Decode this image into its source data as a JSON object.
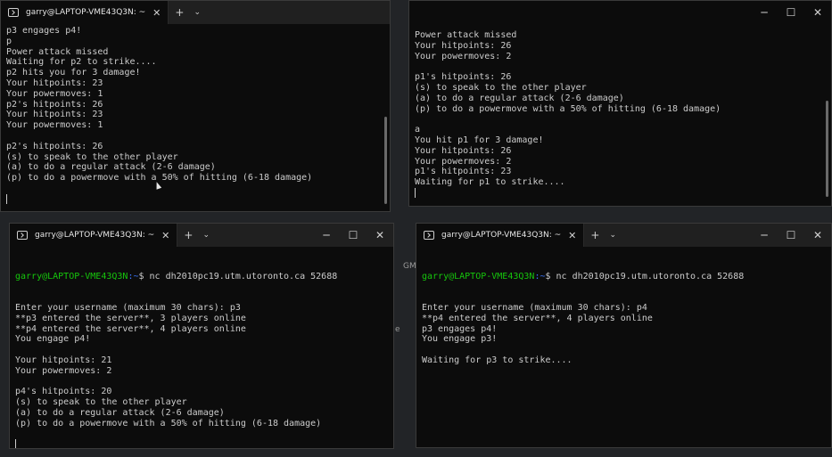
{
  "desktop": {
    "gap_label_1": "GM",
    "gap_label_2": "e"
  },
  "windows": {
    "top_left": {
      "tab_title": "garry@LAPTOP-VME43Q3N: ~",
      "lines": [
        "p3 engages p4!",
        "p",
        "Power attack missed",
        "Waiting for p2 to strike....",
        "p2 hits you for 3 damage!",
        "Your hitpoints: 23",
        "Your powermoves: 1",
        "p2's hitpoints: 26",
        "Your hitpoints: 23",
        "Your powermoves: 1",
        "",
        "p2's hitpoints: 26",
        "(s) to speak to the other player",
        "(a) to do a regular attack (2-6 damage)",
        "(p) to do a powermove with a 50% of hitting (6-18 damage)",
        "",
        ""
      ]
    },
    "top_right": {
      "lines": [
        "Power attack missed",
        "Your hitpoints: 26",
        "Your powermoves: 2",
        "",
        "p1's hitpoints: 26",
        "(s) to speak to the other player",
        "(a) to do a regular attack (2-6 damage)",
        "(p) to do a powermove with a 50% of hitting (6-18 damage)",
        "",
        "a",
        "You hit p1 for 3 damage!",
        "Your hitpoints: 26",
        "Your powermoves: 2",
        "p1's hitpoints: 23",
        "Waiting for p1 to strike....",
        ""
      ]
    },
    "bottom_left": {
      "tab_title": "garry@LAPTOP-VME43Q3N: ~",
      "prompt_user": "garry@LAPTOP-VME43Q3N",
      "prompt_path": ":~",
      "prompt_cmd": "$ nc dh2010pc19.utm.utoronto.ca 52688",
      "lines": [
        "Enter your username (maximum 30 chars): p3",
        "**p3 entered the server**, 3 players online",
        "**p4 entered the server**, 4 players online",
        "You engage p4!",
        "",
        "Your hitpoints: 21",
        "Your powermoves: 2",
        "",
        "p4's hitpoints: 20",
        "(s) to speak to the other player",
        "(a) to do a regular attack (2-6 damage)",
        "(p) to do a powermove with a 50% of hitting (6-18 damage)",
        "",
        ""
      ]
    },
    "bottom_right": {
      "tab_title": "garry@LAPTOP-VME43Q3N: ~",
      "prompt_user": "garry@LAPTOP-VME43Q3N",
      "prompt_path": ":~",
      "prompt_cmd": "$ nc dh2010pc19.utm.utoronto.ca 52688",
      "lines": [
        "Enter your username (maximum 30 chars): p4",
        "**p4 entered the server**, 4 players online",
        "p3 engages p4!",
        "You engage p3!",
        "",
        "Waiting for p3 to strike...."
      ]
    }
  },
  "controls": {
    "new_tab": "+",
    "dropdown": "⌄",
    "close_tab": "✕",
    "minimize": "─",
    "maximize": "☐",
    "close": "✕"
  },
  "icons": {
    "terminal": "terminal-icon"
  },
  "colors": {
    "prompt_user": "#16c60c",
    "prompt_path": "#3b78ff",
    "terminal_bg": "#0c0c0c",
    "terminal_text": "#cccccc"
  }
}
